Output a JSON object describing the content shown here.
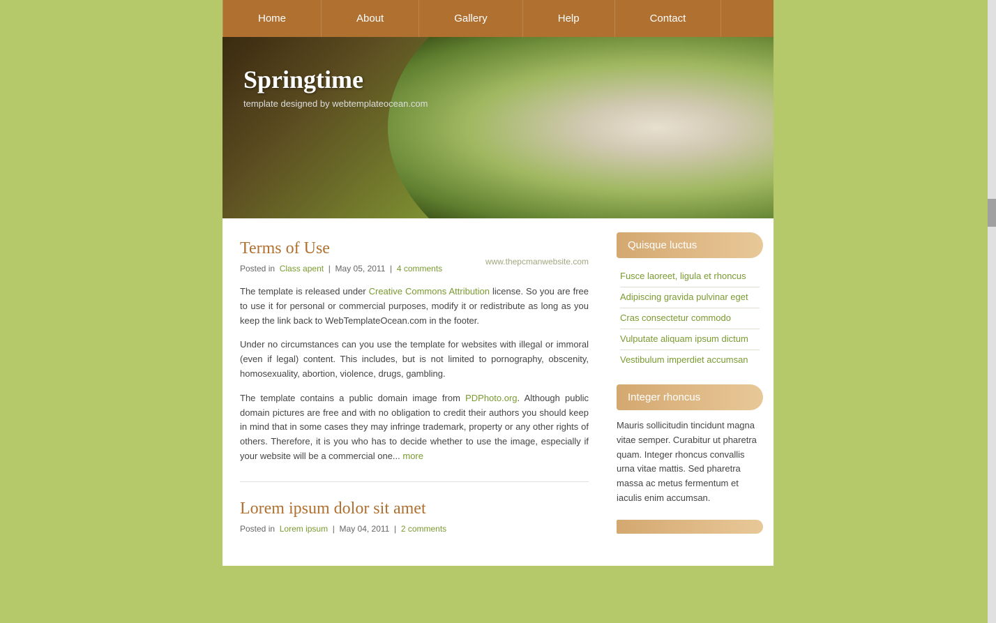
{
  "site": {
    "title": "Springtime",
    "subtitle": "template designed by webtemplateocean.com"
  },
  "nav": {
    "items": [
      {
        "label": "Home",
        "href": "#"
      },
      {
        "label": "About",
        "href": "#"
      },
      {
        "label": "Gallery",
        "href": "#"
      },
      {
        "label": "Help",
        "href": "#"
      },
      {
        "label": "Contact",
        "href": "#"
      }
    ]
  },
  "posts": [
    {
      "title": "Terms of Use",
      "meta_prefix": "Posted in",
      "category_label": "Class apent",
      "date": "May 05, 2011",
      "comments_label": "4 comments",
      "watermark": "www.thepcmanwebsite.com",
      "paragraphs": [
        "The template is released under Creative Commons Attribution license. So you are free to use it for personal or commercial purposes, modify it or redistribute as long as you keep the link back to WebTemplateOcean.com in the footer.",
        "Under no circumstances can you use the template for websites with illegal or immoral (even if legal) content. This includes, but is not limited to pornography, obscenity, homosexuality, abortion, violence, drugs, gambling.",
        "The template contains a public domain image from PDPhoto.org. Although public domain pictures are free and with no obligation to credit their authors you should keep in mind that in some cases they may infringe trademark, property or any other rights of others. Therefore, it is you who has to decide whether to use the image, especially if your website will be a commercial one..."
      ],
      "more_label": "more"
    },
    {
      "title": "Lorem ipsum dolor sit amet",
      "meta_prefix": "Posted in",
      "category_label": "Lorem ipsum",
      "date": "May 04, 2011",
      "comments_label": "2 comments"
    }
  ],
  "sidebar": {
    "widget1": {
      "title": "Quisque luctus",
      "links": [
        "Fusce laoreet, ligula et rhoncus",
        "Adipiscing gravida pulvinar eget",
        "Cras consectetur commodo",
        "Vulputate aliquam ipsum dictum",
        "Vestibulum imperdiet accumsan"
      ]
    },
    "widget2": {
      "title": "Integer rhoncus",
      "text": "Mauris sollicitudin tincidunt magna vitae semper. Curabitur ut pharetra quam. Integer rhoncus convallis urna vitae mattis. Sed pharetra massa ac metus fermentum et iaculis enim accumsan."
    },
    "widget3": {
      "title": ""
    }
  }
}
